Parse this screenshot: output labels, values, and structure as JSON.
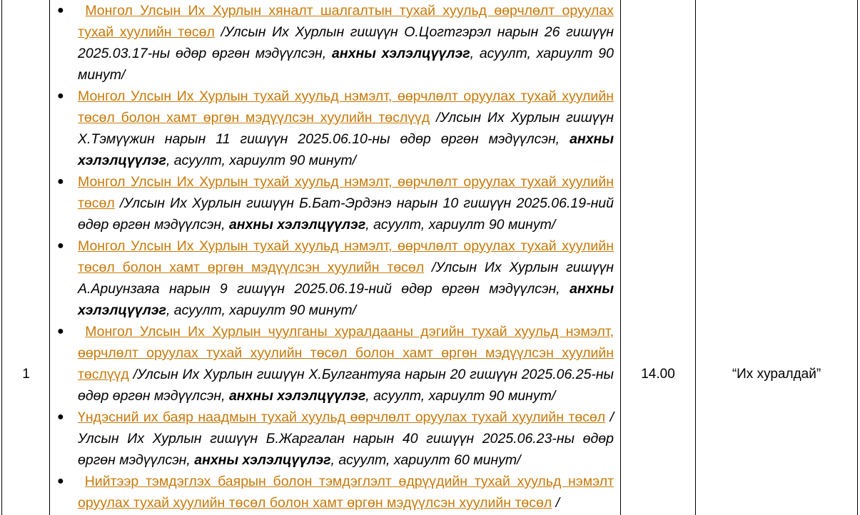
{
  "row": {
    "number": "1",
    "time": "14.00",
    "place": "“Их хуралдай”"
  },
  "items": [
    {
      "lead": " ",
      "bill": "Монгол Улсын Их Хурлын хяналт шалгалтын тухай хуульд өөрчлөлт оруулах тухай хуулийн төсөл",
      "desc_pre": " /Улсын Их Хурлын гишүүн О.Цогтгэрэл нарын 26 гишүүн 2025.03.17-ны өдөр өргөн мэдүүлсэн, ",
      "desc_bold": "анхны хэлэлцүүлэг",
      "desc_post": ", асуулт, хариулт 90 минут/"
    },
    {
      "lead": "",
      "bill": "Монгол Улсын Их Хурлын тухай хуульд нэмэлт, өөрчлөлт оруулах тухай хуулийн төсөл болон хамт өргөн мэдүүлсэн хуулийн төслүүд",
      "desc_pre": " /Улсын Их Хурлын гишүүн Х.Тэмүүжин нарын 11 гишүүн 2025.06.10-ны өдөр өргөн мэдүүлсэн, ",
      "desc_bold": "анхны хэлэлцүүлэг",
      "desc_post": ", асуулт, хариулт 90 минут/"
    },
    {
      "lead": "",
      "bill": "Монгол Улсын Их Хурлын тухай хуульд нэмэлт, өөрчлөлт оруулах тухай хуулийн төсөл",
      "desc_pre": " /Улсын Их Хурлын гишүүн Б.Бат-Эрдэнэ нарын 10 гишүүн 2025.06.19-ний өдөр өргөн мэдүүлсэн, ",
      "desc_bold": "анхны хэлэлцүүлэг",
      "desc_post": ", асуулт, хариулт 90 минут/"
    },
    {
      "lead": "",
      "bill": "Монгол Улсын Их Хурлын тухай хуульд нэмэлт, өөрчлөлт оруулах тухай хуулийн төсөл болон хамт өргөн мэдүүлсэн хуулийн төсөл",
      "desc_pre": " /Улсын Их Хурлын гишүүн А.Ариунзаяа нарын 9 гишүүн 2025.06.19-ний өдөр өргөн мэдүүлсэн, ",
      "desc_bold": "анхны хэлэлцүүлэг",
      "desc_post": ", асуулт, хариулт 90 минут/"
    },
    {
      "lead": " ",
      "bill": "Монгол Улсын Их Хурлын чуулганы хуралдааны дэгийн тухай хуульд нэмэлт, өөрчлөлт оруулах тухай хуулийн төсөл болон хамт өргөн мэдүүлсэн хуулийн төслүүд",
      "desc_pre": " /Улсын Их Хурлын гишүүн Х.Булгантуяа нарын 20 гишүүн 2025.06.25-ны өдөр өргөн мэдүүлсэн, ",
      "desc_bold": "анхны хэлэлцүүлэг",
      "desc_post": ", асуулт, хариулт 90 минут/"
    },
    {
      "lead": "",
      "bill": "Үндэсний их баяр наадмын тухай хуульд өөрчлөлт оруулах тухай хуулийн төсөл",
      "desc_pre": " /Улсын Их Хурлын гишүүн Б.Жаргалан нарын 40 гишүүн 2025.06.23-ны өдөр өргөн мэдүүлсэн, ",
      "desc_bold": "анхны хэлэлцүүлэг",
      "desc_post": ", асуулт, хариулт 60 минут/"
    },
    {
      "lead": " ",
      "bill": "Нийтээр тэмдэглэх баярын болон тэмдэглэлт өдрүүдийн тухай хуульд нэмэлт оруулах тухай хуулийн төсөл болон хамт өргөн мэдүүлсэн хуулийн төсөл",
      "desc_pre": " /",
      "desc_bold": "",
      "desc_post": ""
    }
  ],
  "colors": {
    "link": "#c87a0a",
    "border": "#000000"
  }
}
